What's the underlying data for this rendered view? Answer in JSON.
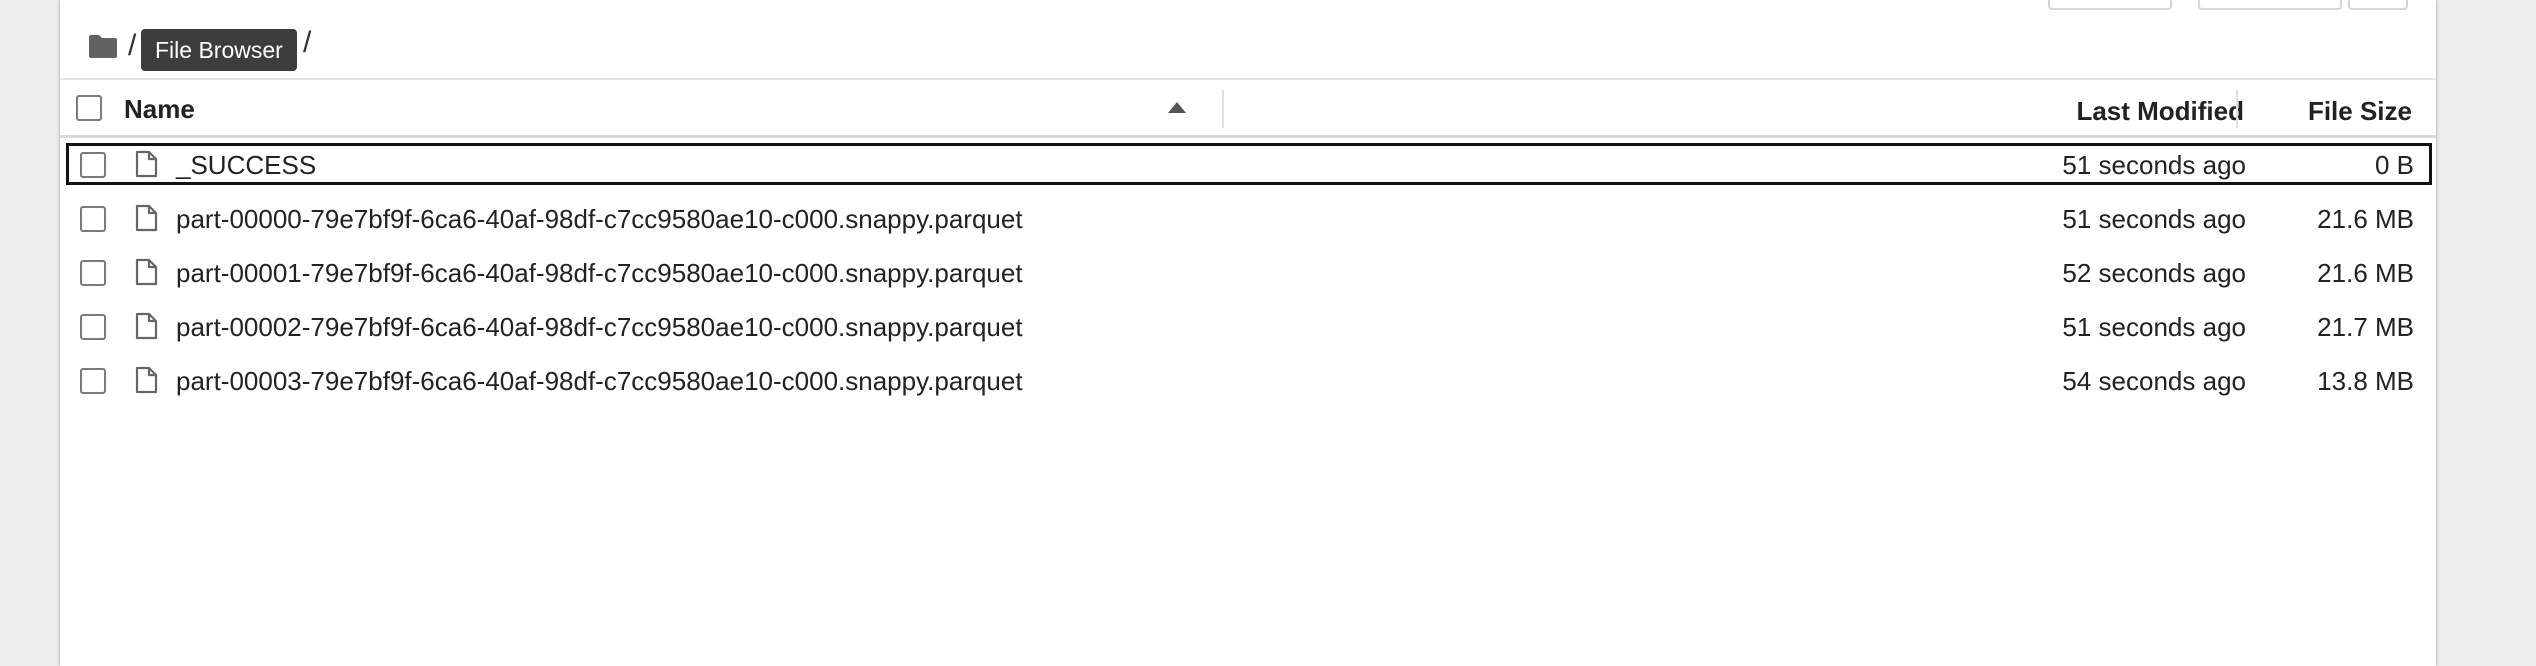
{
  "breadcrumb": {
    "separator": "/",
    "tooltip": "File Browser",
    "trailing_separator": "/"
  },
  "table": {
    "columns": {
      "name": "Name",
      "last_modified": "Last Modified",
      "file_size": "File Size"
    },
    "sort": {
      "column": "name",
      "direction": "ascending"
    },
    "rows": [
      {
        "name": "_SUCCESS",
        "modified": "51 seconds ago",
        "size": "0 B",
        "selected": true
      },
      {
        "name": "part-00000-79e7bf9f-6ca6-40af-98df-c7cc9580ae10-c000.snappy.parquet",
        "modified": "51 seconds ago",
        "size": "21.6 MB",
        "selected": false
      },
      {
        "name": "part-00001-79e7bf9f-6ca6-40af-98df-c7cc9580ae10-c000.snappy.parquet",
        "modified": "52 seconds ago",
        "size": "21.6 MB",
        "selected": false
      },
      {
        "name": "part-00002-79e7bf9f-6ca6-40af-98df-c7cc9580ae10-c000.snappy.parquet",
        "modified": "51 seconds ago",
        "size": "21.7 MB",
        "selected": false
      },
      {
        "name": "part-00003-79e7bf9f-6ca6-40af-98df-c7cc9580ae10-c000.snappy.parquet",
        "modified": "54 seconds ago",
        "size": "13.8 MB",
        "selected": false
      }
    ]
  },
  "icons": {
    "folder": "folder-icon",
    "file": "file-icon",
    "sort": "sort-ascending-icon"
  }
}
